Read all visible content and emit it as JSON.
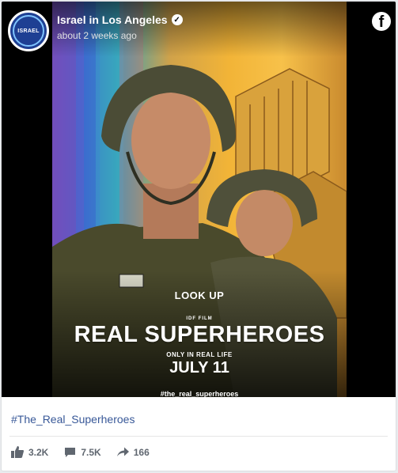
{
  "post": {
    "page_name": "Israel in Los Angeles",
    "timestamp": "about 2 weeks ago",
    "verified": true,
    "avatar_text": "ISRAEL",
    "platform_icon": "facebook-icon"
  },
  "poster": {
    "look_up": "LOOK UP",
    "studio": "IDF FILM",
    "title": "REAL SUPERHEROES",
    "tagline": "ONLY IN REAL LIFE",
    "release": "JULY 11",
    "hashtag": "#the_real_superheroes"
  },
  "caption": {
    "hashtag_link": "#The_Real_Superheroes"
  },
  "stats": {
    "likes": "3.2K",
    "comments": "7.5K",
    "shares": "166"
  },
  "colors": {
    "link": "#385898",
    "avatar_bg": "#1e3f93",
    "stat_text": "#606770"
  }
}
